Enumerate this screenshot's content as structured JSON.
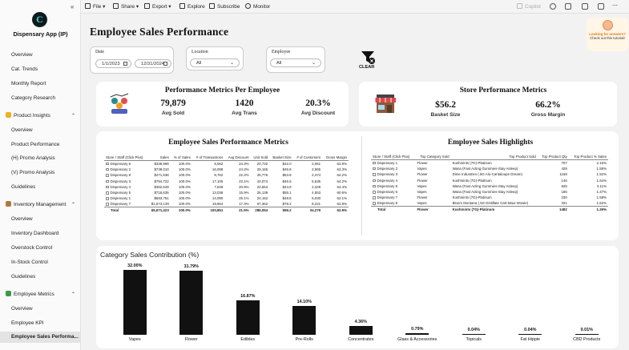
{
  "app": {
    "name": "Dispensary App (IP)",
    "collapse_glyph": "«",
    "logo_letter": "C"
  },
  "sidebar": {
    "items": [
      {
        "label": "Overview",
        "type": "item"
      },
      {
        "label": "Cat. Trends",
        "type": "item"
      },
      {
        "label": "Monthly Report",
        "type": "item"
      },
      {
        "label": "Category Research",
        "type": "item"
      },
      {
        "label": "Product Insights",
        "type": "section",
        "icon": "lightbulb-icon"
      },
      {
        "label": "Overview",
        "type": "item"
      },
      {
        "label": "Product Performance",
        "type": "item"
      },
      {
        "label": "(H) Promo Analysis",
        "type": "item"
      },
      {
        "label": "(V) Promo Analysis",
        "type": "item"
      },
      {
        "label": "Guidelines",
        "type": "item"
      },
      {
        "label": "Inventory Management",
        "type": "section",
        "icon": "box-icon"
      },
      {
        "label": "Overview",
        "type": "item"
      },
      {
        "label": "Inventory Dashboard",
        "type": "item"
      },
      {
        "label": "Overstock Control",
        "type": "item"
      },
      {
        "label": "In-Stock Control",
        "type": "item"
      },
      {
        "label": "Guidelines",
        "type": "item"
      },
      {
        "label": "Employee Metrics",
        "type": "section",
        "icon": "leaf-icon"
      },
      {
        "label": "Overview",
        "type": "item"
      },
      {
        "label": "Employee KPI",
        "type": "item"
      },
      {
        "label": "Employee Sales Performa...",
        "type": "item",
        "active": true
      }
    ]
  },
  "toolbar": {
    "file": "File",
    "share": "Share",
    "export": "Export",
    "explore": "Explore",
    "subscribe": "Subscribe",
    "monitor": "Monitor",
    "copilot": "Copilot"
  },
  "page": {
    "title": "Employee Sales Performance"
  },
  "tip": {
    "line1": "Looking for answers?",
    "line2": "Check out this tutorial!"
  },
  "filters": {
    "date_from": "1/1/2023",
    "date_to": "12/31/2024",
    "location_label": "Location",
    "location_value": "All",
    "employee_label": "Employee",
    "employee_value": "All",
    "clear_label": "CLEAR"
  },
  "metrics_per_employee": {
    "title": "Performance Metrics Per Employee",
    "kpis": [
      {
        "value": "79,879",
        "label": "Avg Sold"
      },
      {
        "value": "1420",
        "label": "Avg Trans"
      },
      {
        "value": "20.3%",
        "label": "Avg Discount"
      }
    ]
  },
  "store_metrics": {
    "title": "Store Performance Metrics",
    "kpis": [
      {
        "value": "$56.2",
        "label": "Basket Size"
      },
      {
        "value": "66.2%",
        "label": "Gross Margin"
      }
    ]
  },
  "employee_sales_table": {
    "title": "Employee Sales Performance Metrics",
    "columns": [
      "Store / Staff (Click Plus)",
      "Sales",
      "% of Sales",
      "# of Transactions",
      "Avg Discount",
      "Unit Sold",
      "Basket Size",
      "# of Customers",
      "Gross Margin"
    ],
    "rows": [
      [
        "Dispensary 6",
        "$338,999",
        "100.0%",
        "8,062",
        "24.3%",
        "20,732",
        "$42.0",
        "2,051",
        "62.9%"
      ],
      [
        "Dispensary 2",
        "$738,010",
        "100.0%",
        "16,098",
        "24.2%",
        "29,165",
        "$45.8",
        "2,965",
        "63.3%"
      ],
      [
        "Dispensary 8",
        "$471,538",
        "100.0%",
        "8,762",
        "22.2%",
        "25,776",
        "$53.8",
        "2,474",
        "64.2%"
      ],
      [
        "Dispensary 3",
        "$794,722",
        "100.0%",
        "17,105",
        "23.1%",
        "43,074",
        "$46.5",
        "5,635",
        "64.2%"
      ],
      [
        "Dispensary 4",
        "$352,649",
        "100.0%",
        "7,849",
        "20.9%",
        "23,654",
        "$44.9",
        "2,349",
        "64.4%"
      ],
      [
        "Dispensary 5",
        "$718,635",
        "100.0%",
        "13,038",
        "15.9%",
        "26,139",
        "$55.1",
        "4,553",
        "60.6%"
      ],
      [
        "Dispensary 1",
        "$683,751",
        "100.0%",
        "14,090",
        "25.1%",
        "24,152",
        "$48.5",
        "6,030",
        "62.1%"
      ],
      [
        "Dispensary 7",
        "$1,573,139",
        "100.0%",
        "19,854",
        "17.3%",
        "67,362",
        "$79.2",
        "8,221",
        "62.8%"
      ]
    ],
    "total": [
      "Total",
      "$5,671,423",
      "100.0%",
      "100,851",
      "21.5%",
      "286,054",
      "$56.2",
      "34,279",
      "62.9%"
    ]
  },
  "highlights_table": {
    "title": "Employee Sales Highlights",
    "columns": [
      "Store / Staff (Click Plus)",
      "Top Category Sold",
      "Top Product Sold",
      "Top Product Qty",
      "Top Product % Sales"
    ],
    "rows": [
      [
        "Dispensary 1",
        "Flower",
        "Kushmints (7G)-Platinum",
        "707",
        "2.15%"
      ],
      [
        "Dispensary 2",
        "Vapes",
        "Wana (Fast Acting Gummies-Stay Asleep)",
        "428",
        "1.55%"
      ],
      [
        "Dispensary 3",
        "Flower",
        "Dime Industries (.5G Alo-Cantaloupe Dream)",
        "1168",
        "1.52%"
      ],
      [
        "Dispensary 4",
        "Flower",
        "Kushmints (7G)-Platinum",
        "146",
        "1.64%"
      ],
      [
        "Dispensary 5",
        "Vapes",
        "Wana (Fast Acting Gummies-Stay Asleep)",
        "845",
        "3.11%"
      ],
      [
        "Dispensary 6",
        "Vapes",
        "Wana (Fast Acting Gummies-Stay Asleep)",
        "185",
        "1.47%"
      ],
      [
        "Dispensary 7",
        "Flower",
        "Kushmints (7G)-Platinum",
        "230",
        "1.58%"
      ],
      [
        "Dispensary 8",
        "Vapes",
        "Bloom Montana (.5G Distillate Cart-Maui Wowie)",
        "331",
        "1.62%"
      ]
    ],
    "total": [
      "Total",
      "Flower",
      "Kushmints (7G)-Platinum",
      "1482",
      "1.26%"
    ]
  },
  "chart_data": {
    "type": "bar",
    "title": "Category Sales Contribution (%)",
    "categories": [
      "Vapes",
      "Flower",
      "Edibles",
      "Pre-Rolls",
      "Concentrates",
      "Glass & Accessories",
      "Topicals",
      "Fat Hippie",
      "CBD Products"
    ],
    "values": [
      32.0,
      31.79,
      16.87,
      14.1,
      4.36,
      0.79,
      0.04,
      0.04,
      0.01
    ],
    "value_labels": [
      "32.00%",
      "31.79%",
      "16.87%",
      "14.10%",
      "4.36%",
      "0.79%",
      "0.04%",
      "0.04%",
      "0.01%"
    ],
    "ylim": [
      0,
      32
    ],
    "grid": false,
    "bar_color": "#111111"
  }
}
